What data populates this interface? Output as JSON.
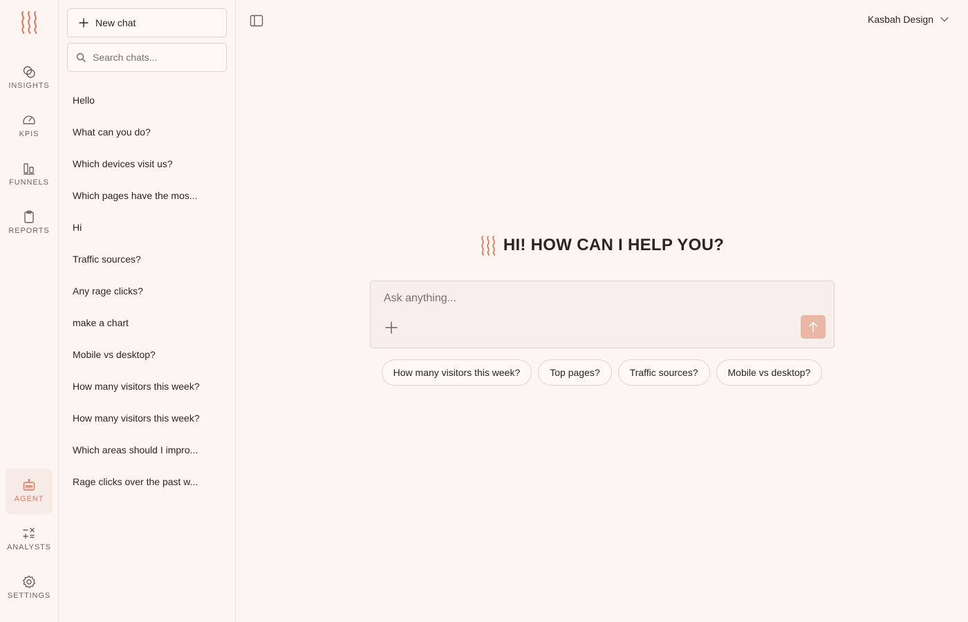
{
  "colors": {
    "background": "#fdf5f2",
    "accent": "#d9785c",
    "send_button": "#eab6a6",
    "border": "#ddd3cf"
  },
  "rail": {
    "logo_icon": "wavy-lines-logo-icon",
    "top_items": [
      {
        "label": "INSIGHTS",
        "icon": "insights-icon"
      },
      {
        "label": "KPIS",
        "icon": "gauge-icon"
      },
      {
        "label": "FUNNELS",
        "icon": "bars-icon"
      },
      {
        "label": "REPORTS",
        "icon": "clipboard-icon"
      }
    ],
    "bottom_items": [
      {
        "label": "AGENT",
        "icon": "robot-icon",
        "active": true
      },
      {
        "label": "ANALYSTS",
        "icon": "calculator-icon"
      },
      {
        "label": "SETTINGS",
        "icon": "gear-icon"
      }
    ]
  },
  "panel": {
    "new_chat_label": "New chat",
    "search_placeholder": "Search chats...",
    "chats": [
      "Hello",
      "What can you do?",
      "Which devices visit us?",
      "Which pages have the mos...",
      "Hi",
      "Traffic sources?",
      "Any rage clicks?",
      "make a chart",
      "Mobile vs desktop?",
      "How many visitors this week?",
      "How many visitors this week?",
      "Which areas should I impro...",
      "Rage clicks over the past w..."
    ]
  },
  "header": {
    "workspace_name": "Kasbah Design"
  },
  "main": {
    "greeting": "HI! HOW CAN I HELP YOU?",
    "input_placeholder": "Ask anything...",
    "suggestions": [
      "How many visitors this week?",
      "Top pages?",
      "Traffic sources?",
      "Mobile vs desktop?"
    ]
  }
}
